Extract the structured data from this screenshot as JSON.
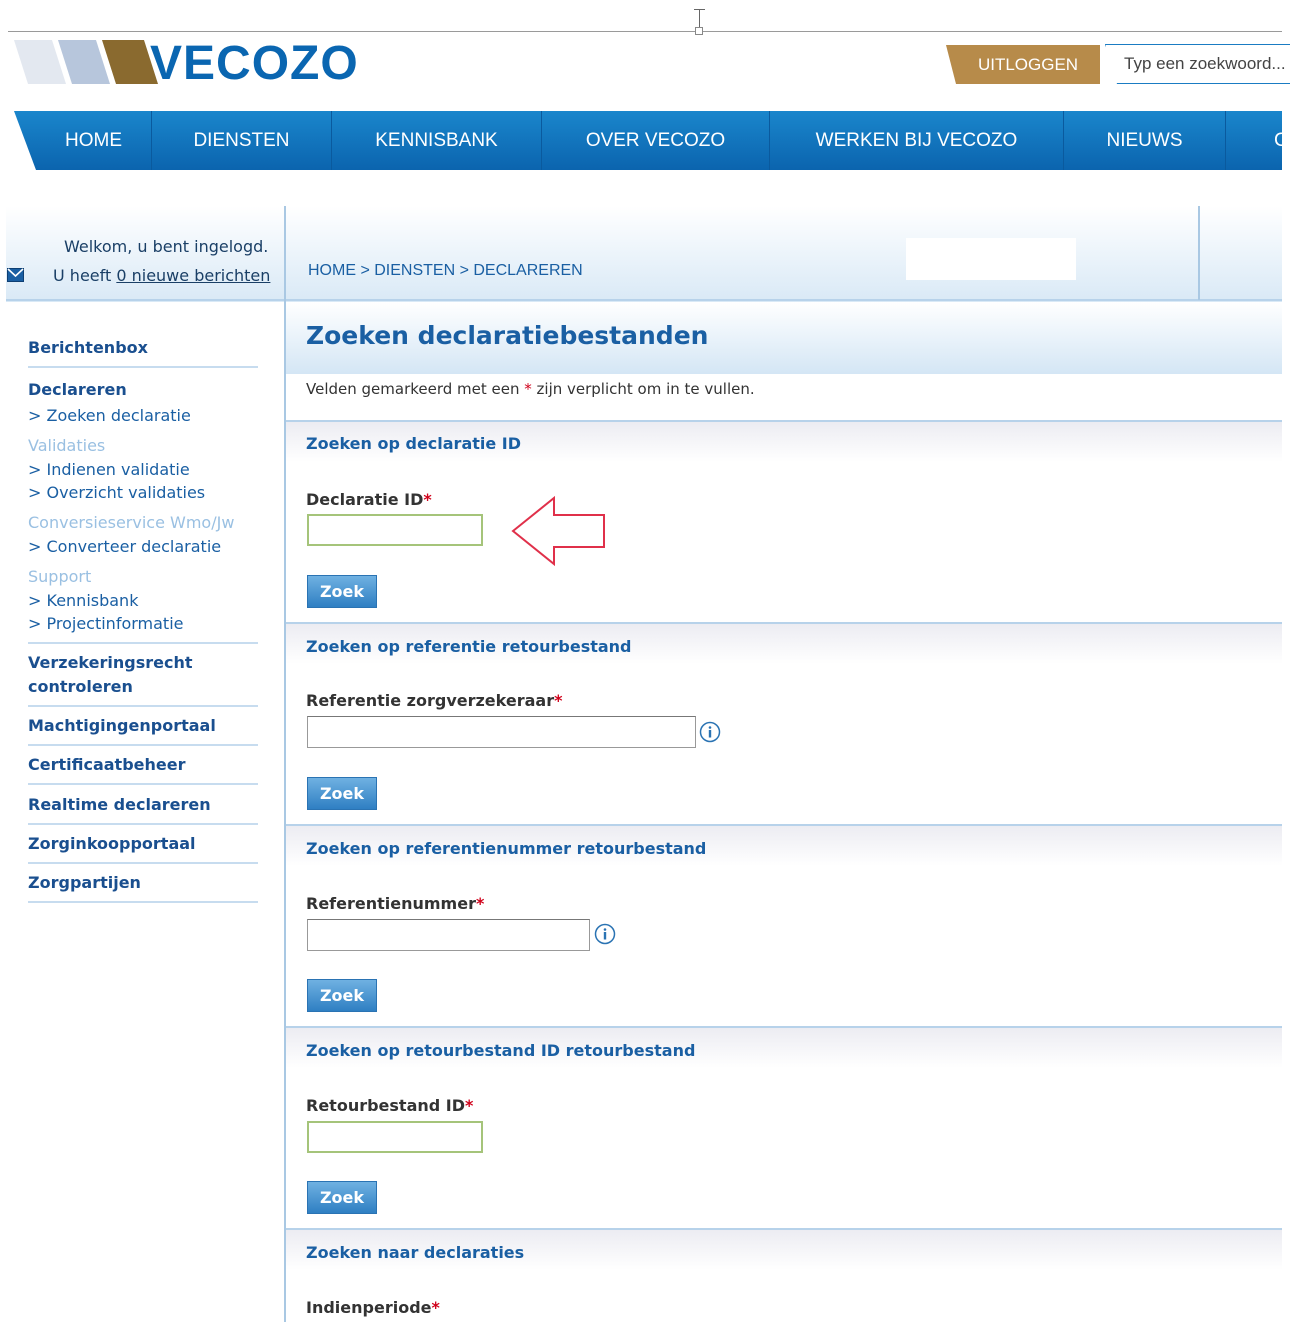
{
  "header": {
    "logo_text": "VECOZO",
    "logout_label": "UITLOGGEN",
    "search_placeholder": "Typ een zoekwoord..."
  },
  "nav": {
    "items": [
      "HOME",
      "DIENSTEN",
      "KENNISBANK",
      "OVER VECOZO",
      "WERKEN BIJ VECOZO",
      "NIEUWS",
      "C"
    ]
  },
  "welcome": {
    "line1": "Welkom, u bent ingelogd.",
    "line2_prefix": "U heeft ",
    "line2_link": "0 nieuwe berichten"
  },
  "breadcrumb": "HOME > DIENSTEN > DECLAREREN",
  "sidebar": {
    "berichtenbox": "Berichtenbox",
    "declareren": "Declareren",
    "zoeken_declaratie": "> Zoeken declaratie",
    "validaties": "Validaties",
    "indienen_validatie": "> Indienen validatie",
    "overzicht_validaties": "> Overzicht validaties",
    "conversieservice": "Conversieservice Wmo/Jw",
    "converteer_declaratie": "> Converteer declaratie",
    "support": "Support",
    "kennisbank": "> Kennisbank",
    "projectinformatie": "> Projectinformatie",
    "verzekeringsrecht_1": "Verzekeringsrecht",
    "verzekeringsrecht_2": "controleren",
    "machtigingenportaal": "Machtigingenportaal",
    "certificaatbeheer": "Certificaatbeheer",
    "realtime_declareren": "Realtime declareren",
    "zorginkoopportaal": "Zorginkoopportaal",
    "zorgpartijen": "Zorgpartijen"
  },
  "main": {
    "title": "Zoeken declaratiebestanden",
    "required_note_prefix": "Velden gemarkeerd met een ",
    "required_star": "*",
    "required_note_suffix": " zijn verplicht om in te vullen.",
    "button_label": "Zoek",
    "sections": {
      "s1": {
        "title": "Zoeken op declaratie ID",
        "label": "Declaratie ID",
        "value": ""
      },
      "s2": {
        "title": "Zoeken op referentie retourbestand",
        "label": "Referentie zorgverzekeraar",
        "value": ""
      },
      "s3": {
        "title": "Zoeken op referentienummer retourbestand",
        "label": "Referentienummer",
        "value": ""
      },
      "s4": {
        "title": "Zoeken op retourbestand ID retourbestand",
        "label": "Retourbestand ID",
        "value": ""
      },
      "s5": {
        "title": "Zoeken naar declaraties",
        "label": "Indienperiode"
      }
    }
  },
  "colors": {
    "brand_blue": "#0a66b1",
    "nav_blue": "#0b64ae",
    "logout_gold": "#b78b4a",
    "required_red": "#d0021b",
    "arrow_red": "#e0304a"
  }
}
